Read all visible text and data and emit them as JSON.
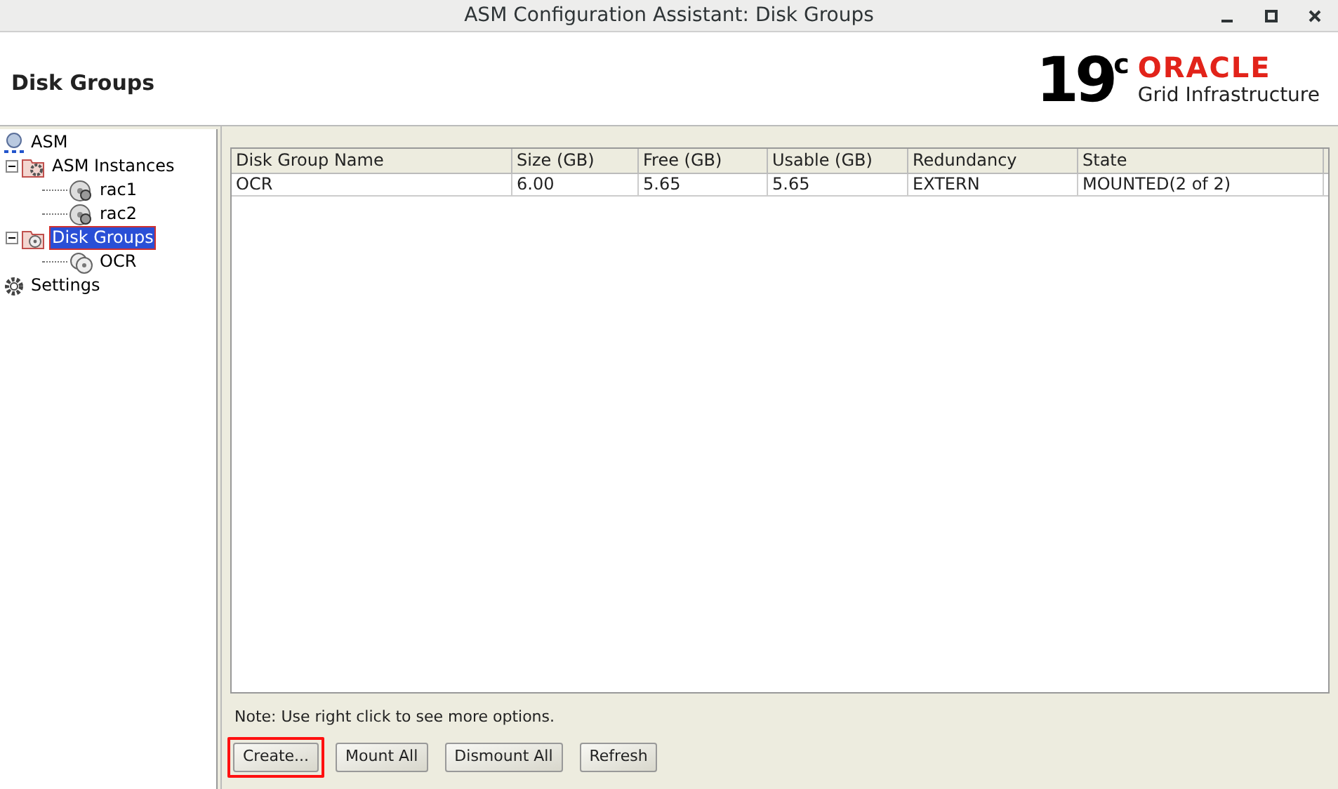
{
  "window": {
    "title": "ASM Configuration Assistant: Disk Groups"
  },
  "header": {
    "title": "Disk Groups",
    "logo_version": "19",
    "logo_sup": "c",
    "logo_brand": "ORACLE",
    "logo_product": "Grid Infrastructure"
  },
  "tree": [
    {
      "label": "ASM",
      "kind": "root",
      "selected": false,
      "children": [
        {
          "label": "ASM Instances",
          "kind": "folder-gear",
          "selected": false,
          "expanded": true,
          "children": [
            {
              "label": "rac1",
              "kind": "disk-gear",
              "selected": false
            },
            {
              "label": "rac2",
              "kind": "disk-gear",
              "selected": false
            }
          ]
        },
        {
          "label": "Disk Groups",
          "kind": "folder-disk",
          "selected": true,
          "expanded": true,
          "children": [
            {
              "label": "OCR",
              "kind": "disks",
              "selected": false
            }
          ]
        }
      ]
    },
    {
      "label": "Settings",
      "kind": "gear",
      "selected": false
    }
  ],
  "table": {
    "columns": [
      "Disk Group Name",
      "Size (GB)",
      "Free (GB)",
      "Usable (GB)",
      "Redundancy",
      "State"
    ],
    "rows": [
      [
        "OCR",
        "6.00",
        "5.65",
        "5.65",
        "EXTERN",
        "MOUNTED(2 of 2)"
      ]
    ]
  },
  "note": "Note: Use right click to see more options.",
  "buttons": [
    {
      "label": "Create...",
      "highlighted": true
    },
    {
      "label": "Mount All",
      "highlighted": false
    },
    {
      "label": "Dismount All",
      "highlighted": false
    },
    {
      "label": "Refresh",
      "highlighted": false
    }
  ]
}
